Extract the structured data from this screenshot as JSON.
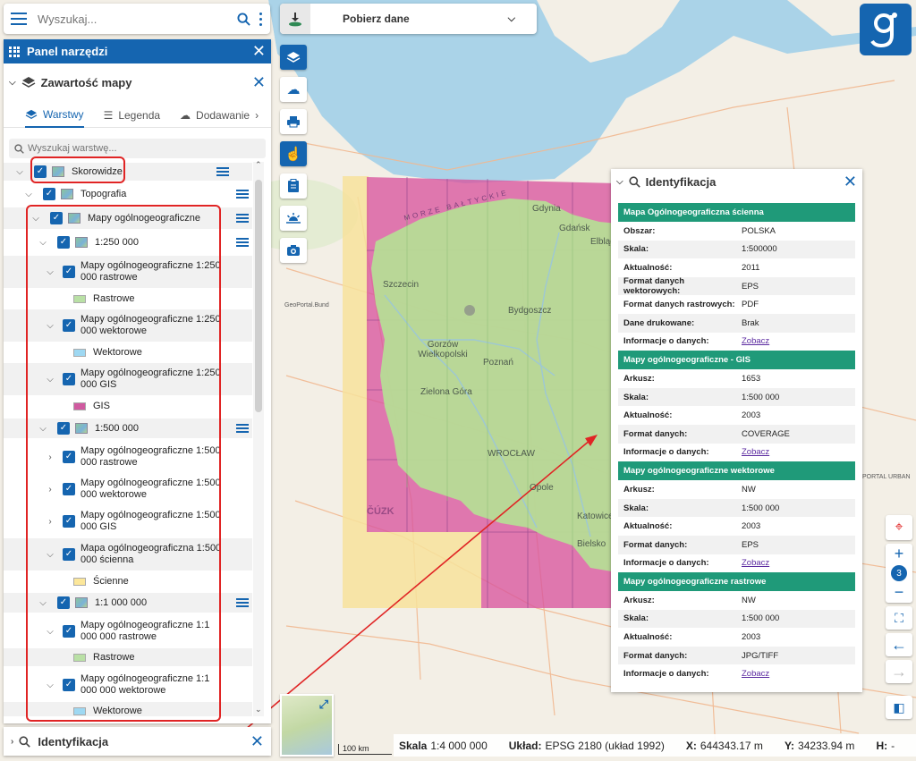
{
  "search": {
    "placeholder": "Wyszukaj..."
  },
  "panel": {
    "title": "Panel narzędzi",
    "content_title": "Zawartość mapy",
    "tabs": [
      {
        "label": "Warstwy",
        "active": true
      },
      {
        "label": "Legenda",
        "active": false
      },
      {
        "label": "Dodawanie",
        "active": false
      }
    ],
    "layer_search_placeholder": "Wyszukaj warstwę...",
    "tree": {
      "skorowidze": "Skorowidze",
      "topografia": "Topografia",
      "mapy_ogolno": "Mapy ogólnogeograficzne",
      "g250": "1:250 000",
      "g250_rastrowe": "Mapy ogólnogeograficzne 1:250 000 rastrowe",
      "leg_rastrowe": "Rastrowe",
      "g250_wektorowe": "Mapy ogólnogeograficzne 1:250 000 wektorowe",
      "leg_wektorowe": "Wektorowe",
      "g250_gis": "Mapy ogólnogeograficzne 1:250 000 GIS",
      "leg_gis": "GIS",
      "g500": "1:500 000",
      "g500_rastrowe": "Mapy ogólnogeograficzne 1:500 000 rastrowe",
      "g500_wektorowe": "Mapy ogólnogeograficzne 1:500 000 wektorowe",
      "g500_gis": "Mapy ogólnogeograficzne 1:500 000 GIS",
      "g500_scienna": "Mapa ogólnogeograficzna 1:500 000 ścienna",
      "leg_scienne": "Ścienne",
      "g1m": "1:1 000 000",
      "g1m_rastrowe": "Mapy ogólnogeograficzne 1:1 000 000 rastrowe",
      "leg_rastrowe2": "Rastrowe",
      "g1m_wektorowe": "Mapy ogólnogeograficzne 1:1 000 000 wektorowe",
      "leg_wektorowe2": "Wektorowe"
    },
    "identification_title": "Identyfikacja"
  },
  "download": {
    "label": "Pobierz dane"
  },
  "map": {
    "labels": {
      "gdynia": "Gdynia",
      "gdansk": "Gdańsk",
      "elblag": "Elbląg",
      "szczecin": "Szczecin",
      "bydgoszcz": "Bydgoszcz",
      "gorzow": "Gorzów Wielkopolski",
      "poznan": "Poznań",
      "zielona_gora": "Zielona Góra",
      "wroclaw": "WROCŁAW",
      "opole": "Opole",
      "katowice": "Katowice",
      "bielsko": "Bielsko",
      "morze": "MORZE BAŁTYCKIE",
      "cuzk": "ČÚZK",
      "geoportal": "GeoPortal.Bund",
      "portal_urban": "PORTAL URBAN"
    }
  },
  "identification": {
    "title": "Identyfikacja",
    "sections": [
      {
        "title": "Mapa Ogólnogeograficzna ścienna",
        "rows": [
          {
            "k": "Obszar:",
            "v": "POLSKA"
          },
          {
            "k": "Skala:",
            "v": "1:500000"
          },
          {
            "k": "Aktualność:",
            "v": "2011"
          },
          {
            "k": "Format danych wektorowych:",
            "v": "EPS"
          },
          {
            "k": "Format danych rastrowych:",
            "v": "PDF"
          },
          {
            "k": "Dane drukowane:",
            "v": "Brak"
          },
          {
            "k": "Informacje o danych:",
            "v": "Zobacz",
            "link": true
          }
        ]
      },
      {
        "title": "Mapy ogólnogeograficzne - GIS",
        "rows": [
          {
            "k": "Arkusz:",
            "v": "1653"
          },
          {
            "k": "Skala:",
            "v": "1:500 000"
          },
          {
            "k": "Aktualność:",
            "v": "2003"
          },
          {
            "k": "Format danych:",
            "v": "COVERAGE"
          },
          {
            "k": "Informacje o danych:",
            "v": "Zobacz",
            "link": true
          }
        ]
      },
      {
        "title": "Mapy ogólnogeograficzne wektorowe",
        "rows": [
          {
            "k": "Arkusz:",
            "v": "NW"
          },
          {
            "k": "Skala:",
            "v": "1:500 000"
          },
          {
            "k": "Aktualność:",
            "v": "2003"
          },
          {
            "k": "Format danych:",
            "v": "EPS"
          },
          {
            "k": "Informacje o danych:",
            "v": "Zobacz",
            "link": true
          }
        ]
      },
      {
        "title": "Mapy ogólnogeograficzne rastrowe",
        "rows": [
          {
            "k": "Arkusz:",
            "v": "NW"
          },
          {
            "k": "Skala:",
            "v": "1:500 000"
          },
          {
            "k": "Aktualność:",
            "v": "2003"
          },
          {
            "k": "Format danych:",
            "v": "JPG/TIFF"
          },
          {
            "k": "Informacje o danych:",
            "v": "Zobacz",
            "link": true
          }
        ]
      }
    ]
  },
  "controls": {
    "zoom_level": "3"
  },
  "status": {
    "scale_label": "Skala",
    "scale_value": "1:4 000 000",
    "crs_label": "Układ:",
    "crs_value": "EPSG 2180 (układ 1992)",
    "x_label": "X:",
    "x_value": "644343.17 m",
    "y_label": "Y:",
    "y_value": "34233.94 m",
    "h_label": "H:",
    "h_value": "-",
    "scalebar": "100 km"
  },
  "colors": {
    "brand_blue": "#1565b0",
    "section_green": "#1f9a79",
    "annotation_red": "#e02424",
    "legend_rastrowe": "#b9e0a5",
    "legend_wektorowe": "#9ed8f2",
    "legend_gis": "#d05aa0",
    "legend_scienne": "#fce79a"
  }
}
